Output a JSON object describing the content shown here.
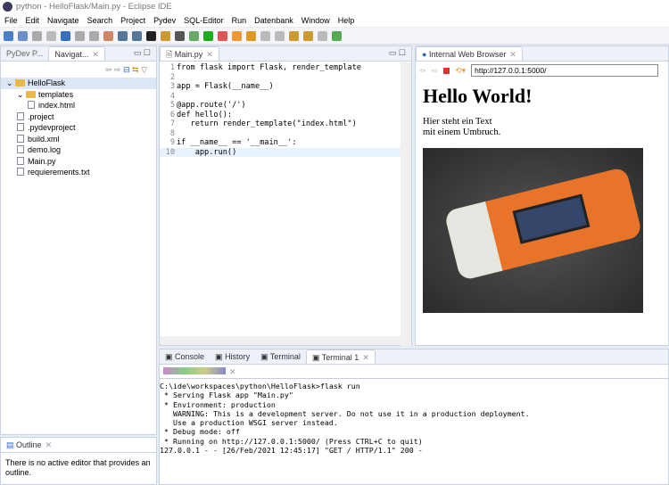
{
  "window": {
    "title": "python - HelloFlask/Main.py - Eclipse IDE"
  },
  "menu": [
    "File",
    "Edit",
    "Navigate",
    "Search",
    "Project",
    "Pydev",
    "SQL-Editor",
    "Run",
    "Datenbank",
    "Window",
    "Help"
  ],
  "navigator": {
    "tabs": [
      "PyDev P...",
      "Navigat..."
    ],
    "tree": [
      {
        "label": "HelloFlask",
        "type": "project",
        "depth": 0
      },
      {
        "label": "templates",
        "type": "folder",
        "depth": 1
      },
      {
        "label": "index.html",
        "type": "file",
        "depth": 2
      },
      {
        "label": ".project",
        "type": "file",
        "depth": 1
      },
      {
        "label": ".pydevproject",
        "type": "file",
        "depth": 1
      },
      {
        "label": "build.xml",
        "type": "file",
        "depth": 1
      },
      {
        "label": "demo.log",
        "type": "file",
        "depth": 1
      },
      {
        "label": "Main.py",
        "type": "file",
        "depth": 1
      },
      {
        "label": "requierements.txt",
        "type": "file",
        "depth": 1
      }
    ]
  },
  "outline": {
    "tab": "Outline",
    "message": "There is no active editor that provides an outline."
  },
  "editor": {
    "tab": "Main.py",
    "lines": [
      "from flask import Flask, render_template",
      "",
      "app = Flask(__name__)",
      "",
      "@app.route('/')",
      "def hello():",
      "   return render_template(\"index.html\")",
      "",
      "if __name__ == '__main__':",
      "    app.run()"
    ]
  },
  "browser": {
    "tab": "Internal Web Browser",
    "url": "http://127.0.0.1:5000/",
    "heading": "Hello World!",
    "text_line1": "Hier steht ein Text",
    "text_line2": "mit einem Umbruch."
  },
  "console": {
    "tabs": [
      "Console",
      "History",
      "Terminal",
      "Terminal 1"
    ],
    "lines": [
      "C:\\ide\\workspaces\\python\\HelloFlask>flask run",
      " * Serving Flask app \"Main.py\"",
      " * Environment: production",
      "   WARNING: This is a development server. Do not use it in a production deployment.",
      "   Use a production WSGI server instead.",
      " * Debug mode: off",
      " * Running on http://127.0.0.1:5000/ (Press CTRL+C to quit)",
      "127.0.0.1 - - [26/Feb/2021 12:45:17] \"GET / HTTP/1.1\" 200 -"
    ]
  }
}
